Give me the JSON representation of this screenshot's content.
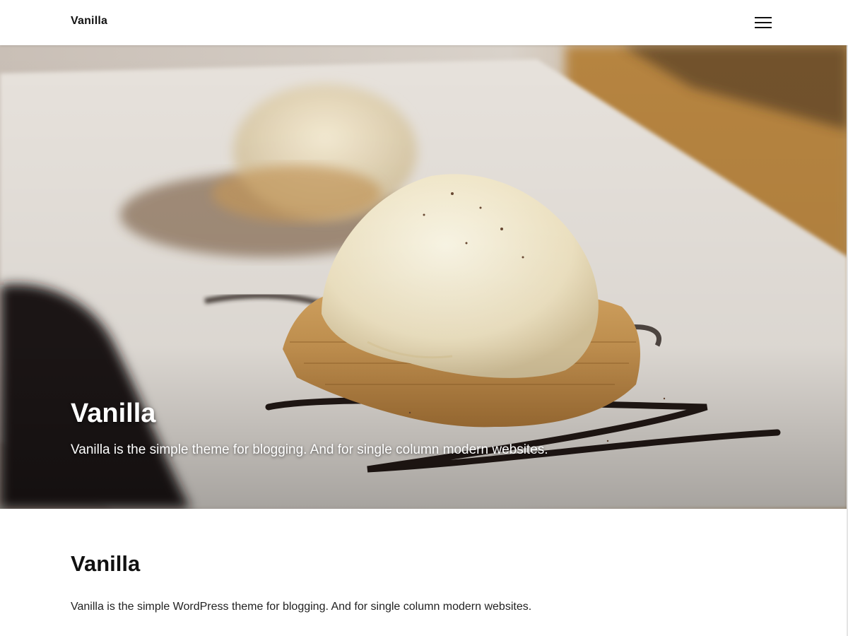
{
  "header": {
    "site_title": "Vanilla",
    "menu_icon": "hamburger-menu-icon"
  },
  "hero": {
    "title": "Vanilla",
    "description": "Vanilla is the simple theme for blogging. And for single column modern websites."
  },
  "content": {
    "title": "Vanilla",
    "text": "Vanilla is the simple WordPress theme for blogging. And for single column modern websites."
  },
  "colors": {
    "header_background": "#ffffff",
    "text": "#111111",
    "hero_text": "#ffffff"
  }
}
